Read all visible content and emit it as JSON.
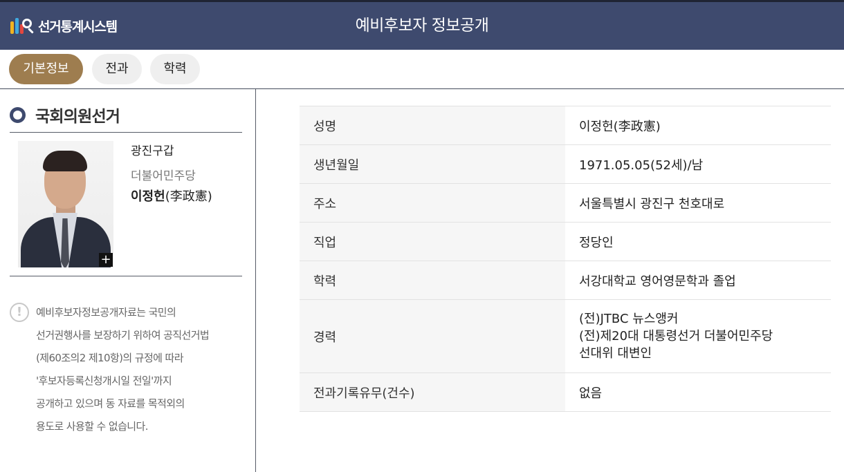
{
  "header": {
    "logo_text": "선거통계시스템",
    "title": "예비후보자 정보공개"
  },
  "tabs": [
    {
      "label": "기본정보",
      "active": true
    },
    {
      "label": "전과",
      "active": false
    },
    {
      "label": "학력",
      "active": false
    }
  ],
  "sidebar": {
    "section_title": "국회의원선거",
    "candidate": {
      "district": "광진구갑",
      "party": "더불어민주당",
      "name": "이정헌",
      "hanja": "(李政憲)",
      "zoom_label": "+"
    },
    "notice_icon": "!",
    "notice_lines": [
      "예비후보자정보공개자료는 국민의",
      "선거권행사를 보장하기 위하여 공직선거법",
      "(제60조의2 제10항)의 규정에 따라",
      "'후보자등록신청개시일 전일'까지",
      "공개하고 있으며 동 자료를 목적외의",
      "용도로 사용할 수 없습니다."
    ]
  },
  "info": {
    "rows": [
      {
        "label": "성명",
        "value": "이정헌(李政憲)"
      },
      {
        "label": "생년월일",
        "value": "1971.05.05(52세)/남"
      },
      {
        "label": "주소",
        "value": "서울특별시 광진구 천호대로"
      },
      {
        "label": "직업",
        "value": "정당인"
      },
      {
        "label": "학력",
        "value": "서강대학교 영어영문학과 졸업"
      }
    ],
    "career": {
      "label": "경력",
      "lines": [
        "(전)JTBC 뉴스앵커",
        "(전)제20대 대통령선거 더불어민주당",
        "선대위 대변인"
      ]
    },
    "criminal": {
      "label": "전과기록유무(건수)",
      "value": "없음"
    }
  },
  "colors": {
    "header_bg": "#3e4a6e",
    "active_tab": "#9e7d4f",
    "table_label_bg": "#f6f6f6"
  }
}
